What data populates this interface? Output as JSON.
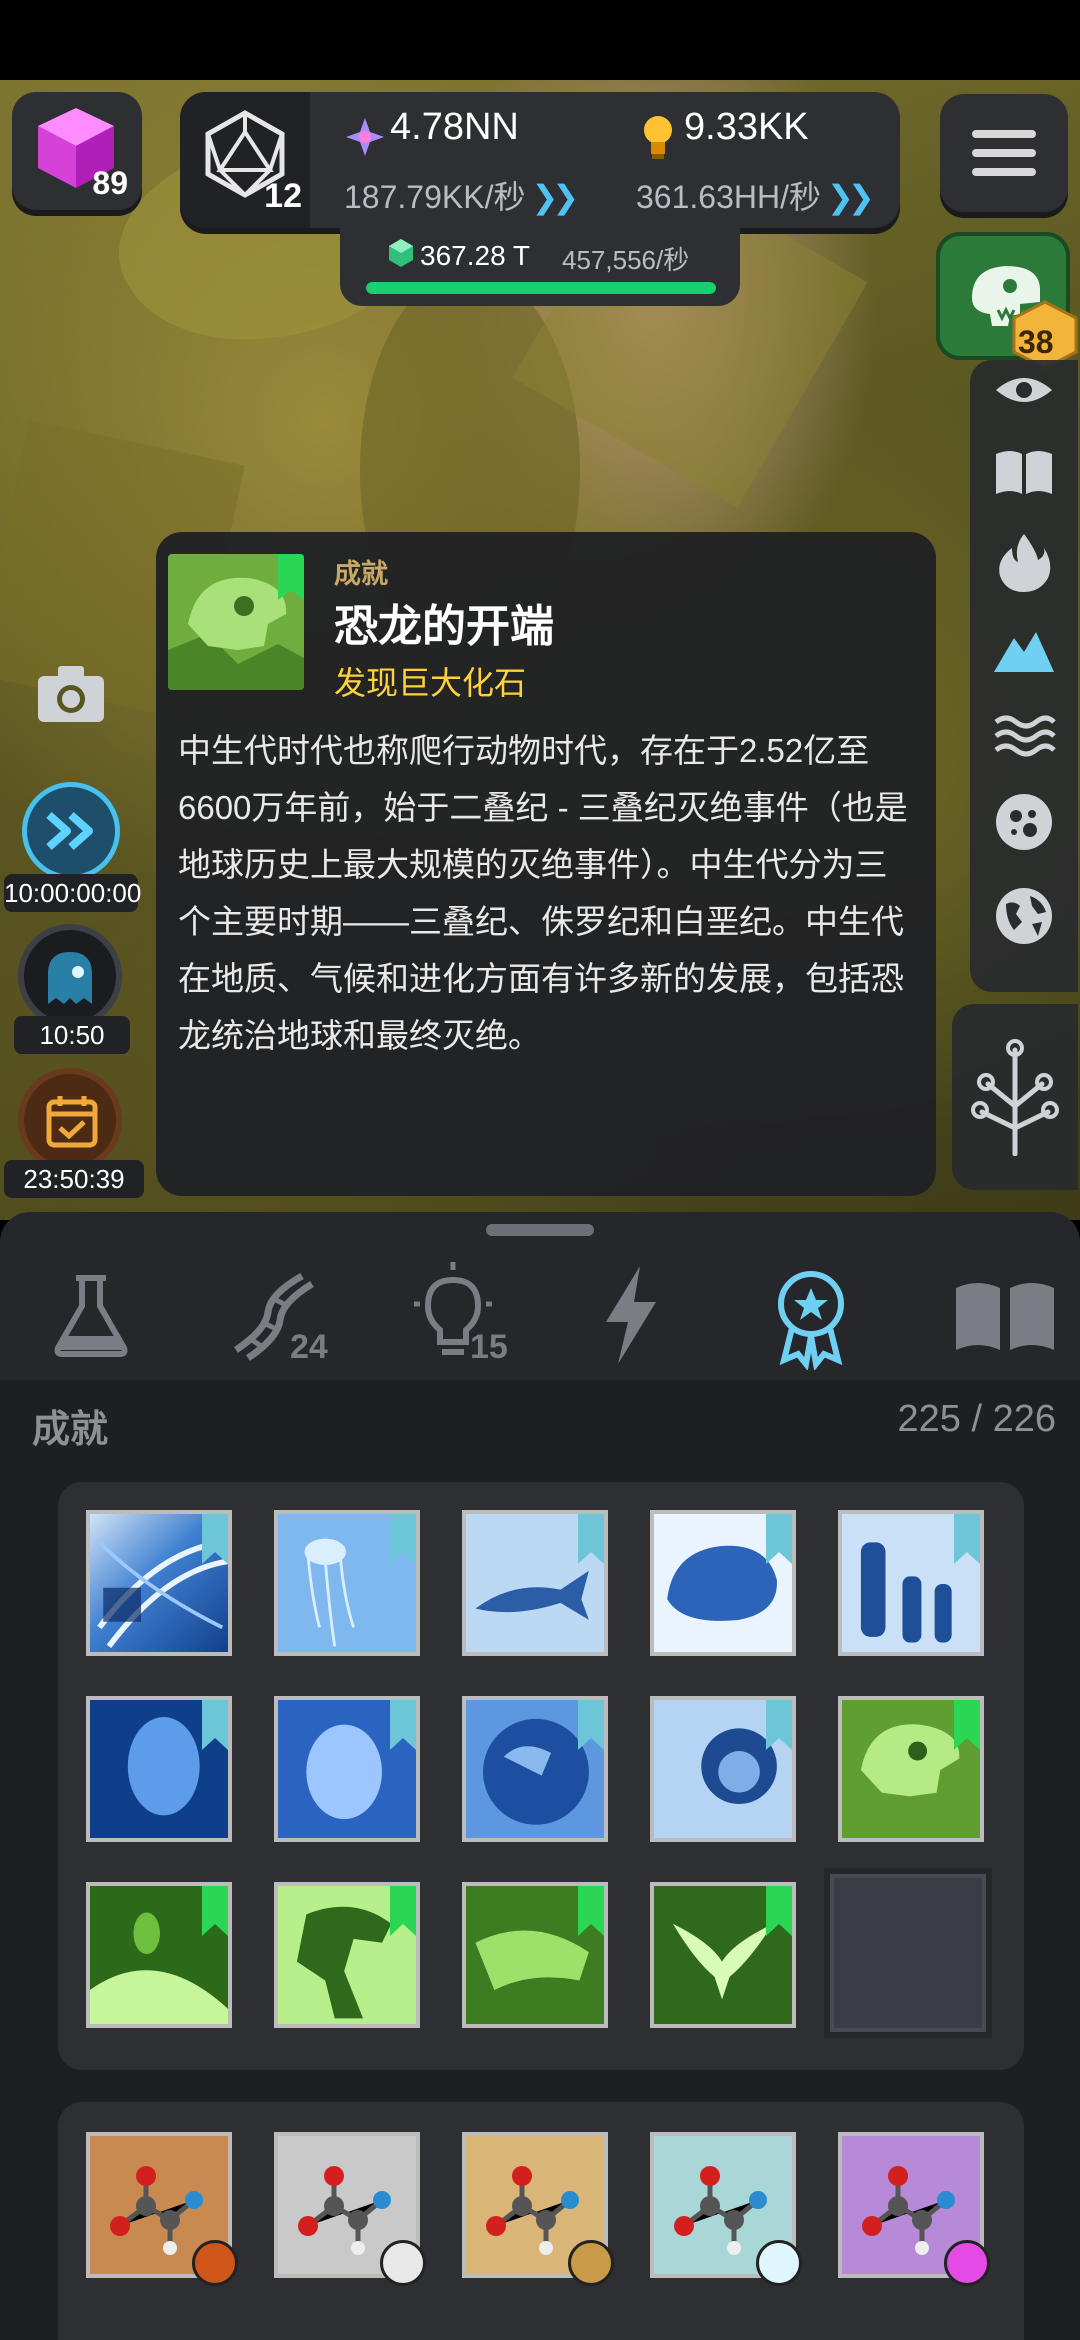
{
  "top_bar": {
    "cube_count": "89",
    "d20_level": "12",
    "resource1": {
      "value": "4.78NN",
      "rate": "187.79KK/秒"
    },
    "resource2": {
      "value": "9.33KK",
      "rate": "361.63HH/秒"
    },
    "gem": {
      "value": "367.28 T",
      "rate": "457,556/秒",
      "progress": 1.0
    }
  },
  "side": {
    "dino_badge": "38",
    "rail_icons": [
      "eye-icon",
      "book-icon",
      "fire-icon",
      "mountain-icon",
      "waves-icon",
      "cell-icon",
      "globe-icon"
    ],
    "active_rail_icon": "mountain-icon"
  },
  "left": {
    "boost_timer": "10:00:00:00",
    "ghost_timer": "10:50",
    "calendar_timer": "23:50:39"
  },
  "tooltip": {
    "category": "成就",
    "title": "恐龙的开端",
    "subtitle": "发现巨大化石",
    "description": "中生代时代也称爬行动物时代，存在于2.52亿至6600万年前，始于二叠纪 - 三叠纪灭绝事件（也是地球历史上最大规模的灭绝事件）。中生代分为三个主要时期——三叠纪、侏罗纪和白垩纪。中生代在地质、气候和进化方面有许多新的发展，包括恐龙统治地球和最终灭绝。"
  },
  "tabs": [
    {
      "icon": "flask-icon",
      "badge": ""
    },
    {
      "icon": "dna-icon",
      "badge": "24"
    },
    {
      "icon": "lightbulb-icon",
      "badge": "15"
    },
    {
      "icon": "lightning-icon",
      "badge": ""
    },
    {
      "icon": "achievement-medal-icon",
      "badge": "",
      "active": true
    },
    {
      "icon": "book-icon",
      "badge": ""
    }
  ],
  "achievements": {
    "section_title": "成就",
    "count": "225 / 226",
    "rows": [
      [
        "blue:dna",
        "blue:jellyfish",
        "blue:fish",
        "blue:rock",
        "blue:humans"
      ],
      [
        "blue:face",
        "blue:face2",
        "blue:earth",
        "blue:lion",
        "green:dino-skull"
      ],
      [
        "green:planet",
        "green:trex",
        "green:croc",
        "green:bird",
        "empty"
      ]
    ]
  },
  "molecules": {
    "tiles": [
      {
        "color": "#c98a52",
        "badge": "#d0561a"
      },
      {
        "color": "#c9c9c9",
        "badge": "#e8e8e8"
      },
      {
        "color": "#d9b677",
        "badge": "#c89a4a"
      },
      {
        "color": "#a9d6d6",
        "badge": "#dff6ff"
      },
      {
        "color": "#b78ad8",
        "badge": "#e44ae6"
      }
    ]
  },
  "colors": {
    "accent": "#47c1ee",
    "gold": "#ffd23a",
    "green_progress": "#18d070"
  }
}
